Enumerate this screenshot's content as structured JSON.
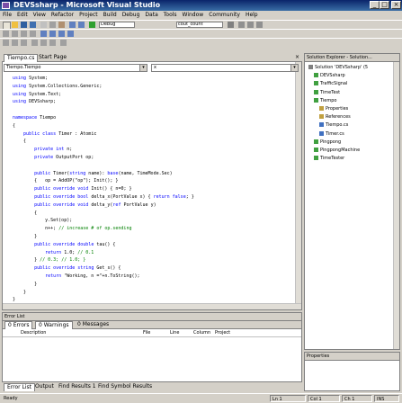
{
  "window": {
    "title": "DEVSsharp - Microsoft Visual Studio"
  },
  "menu": [
    "File",
    "Edit",
    "View",
    "Refactor",
    "Project",
    "Build",
    "Debug",
    "Data",
    "Tools",
    "Window",
    "Community",
    "Help"
  ],
  "toolbar1": {
    "config": "Debug",
    "search": "cout_count"
  },
  "editor": {
    "tabs": [
      "Tiempo.cs",
      "Start Page"
    ],
    "class_combo": "Tiempo.Tiempo",
    "member_combo": "x",
    "lines": [
      "using System;",
      "using System.Collections.Generic;",
      "using System.Text;",
      "using DEVSsharp;",
      "",
      "namespace Tiempo",
      "{",
      "    public class Timer : Atomic",
      "    {",
      "        private int n;",
      "        private OutputPort op;",
      "",
      "        public Timer(string name): base(name, TimeMode.Sec)",
      "        {   op = AddOP(\"op\"); Init(); }",
      "        public override void Init() { n=0; }",
      "        public override bool delta_x(PortValue x) { return false; }",
      "        public override void delta_y(ref PortValue y)",
      "        {",
      "            y.Set(op);",
      "            n++; // increase # of op.sending",
      "        }",
      "        public override double tau() {",
      "            return 1.0; // 0.1",
      "        } // 0.3; // 1.0; }",
      "        public override string Get_s() {",
      "            return \"Working, n =\"+n.ToString();",
      "        }",
      "    }",
      "}"
    ]
  },
  "solution": {
    "title": "Solution Explorer - Solution...",
    "items": [
      "Solution 'DEVSsharp' (5",
      "DEVSsharp",
      "TrafficSignal",
      "TimeTest",
      "Tiempo",
      "Properties",
      "References",
      "Tiempo.cs",
      "Timer.cs",
      "Pingpong",
      "PingpongMachine",
      "TimeTester"
    ]
  },
  "properties": {
    "title": "Properties"
  },
  "output": {
    "title": "Error List",
    "tabs": [
      "0 Errors",
      "0 Warnings",
      "0 Messages"
    ],
    "cols": [
      "Description",
      "File",
      "Line",
      "Column",
      "Project"
    ]
  },
  "bottom_tabs": [
    "Error List",
    "Output",
    "Find Results 1",
    "Find Symbol Results"
  ],
  "status": {
    "left": "Ready",
    "ln": "Ln 1",
    "col": "Col 1",
    "ch": "Ch 1",
    "ins": "INS"
  }
}
